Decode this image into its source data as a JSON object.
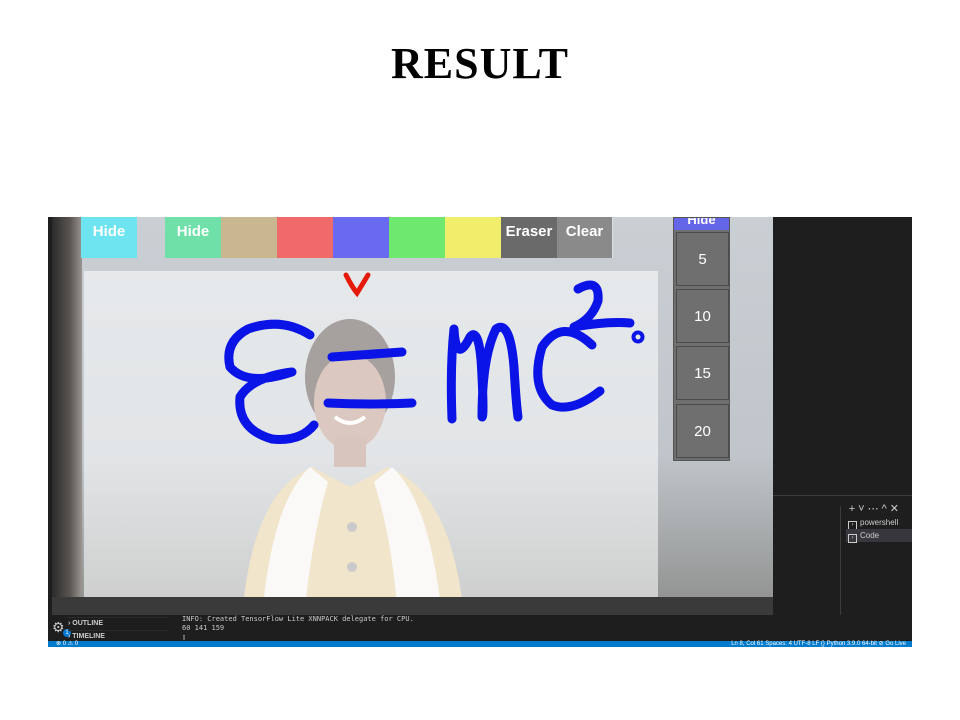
{
  "slide": {
    "title": "RESULT"
  },
  "toolbar": {
    "hide_left": "Hide",
    "hide_main": "Hide",
    "eraser": "Eraser",
    "clear": "Clear",
    "colors": [
      "#c8b78f",
      "#f06a6a",
      "#6a6af0",
      "#6ee86e",
      "#f0ee6a"
    ]
  },
  "sizes": {
    "hide": "Hide",
    "s5": "5",
    "s10": "10",
    "s15": "15",
    "s20": "20"
  },
  "vscode": {
    "outline": "OUTLINE",
    "timeline": "TIMELINE",
    "terminal_line1": "INFO: Created TensorFlow Lite XNNPACK delegate for CPU.",
    "terminal_line2": "60 141 159",
    "terminal_cursor": "▯",
    "term_powershell": "powershell",
    "term_code": "Code",
    "status_left": "⊗ 0 ⚠ 0",
    "status_right": "Ln 8, Col 61   Spaces: 4   UTF-8   LF   {} Python   3.9.0 64-bit   ⊘ Go Live"
  },
  "drawing": {
    "equation": "E = mc²",
    "ink_color": "#0a14e6",
    "mark_color": "#e61a0a"
  }
}
